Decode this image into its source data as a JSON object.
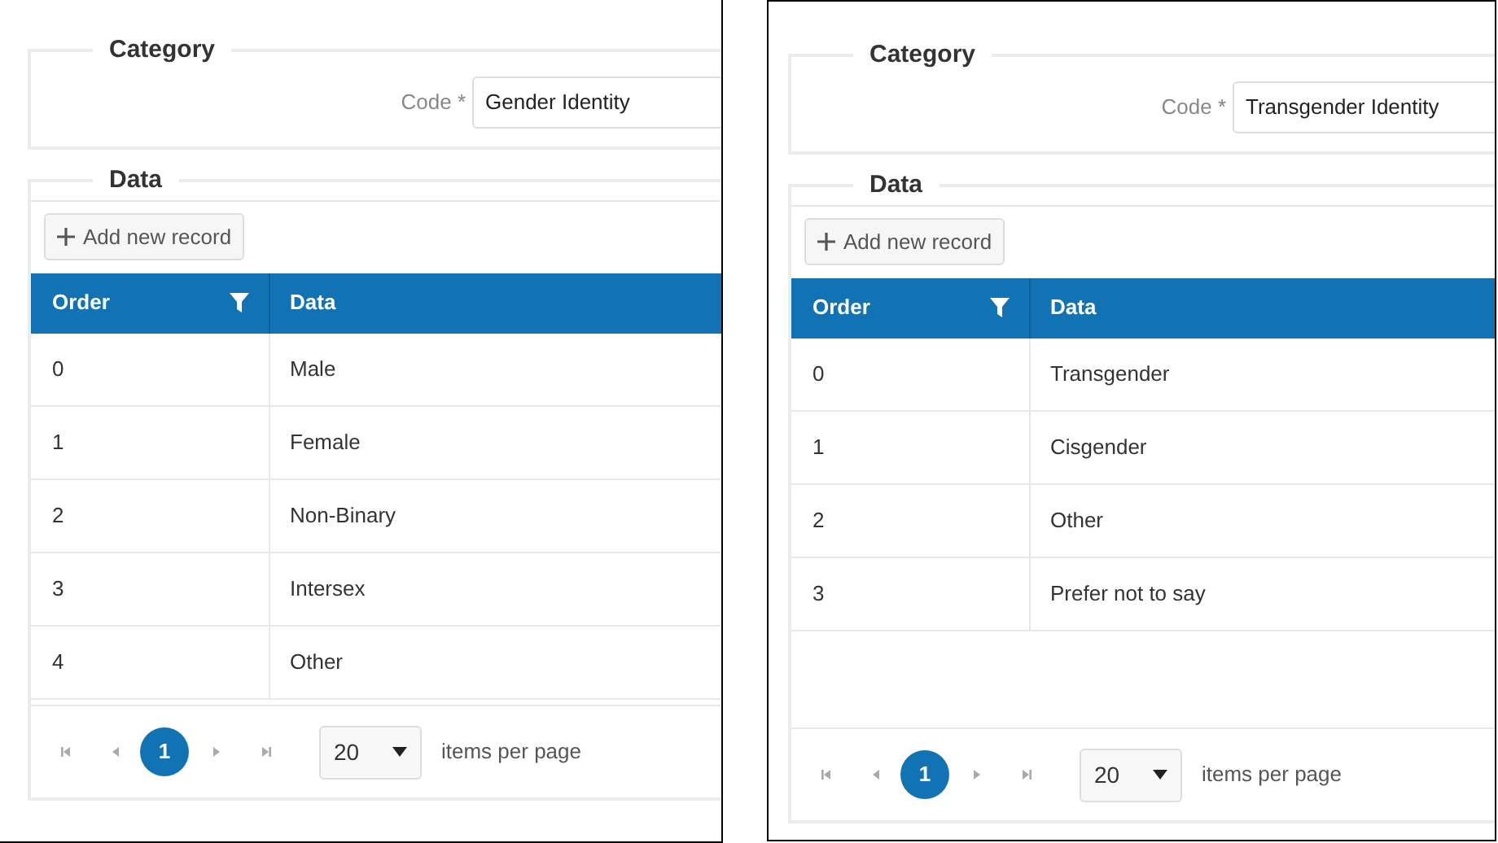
{
  "panels": [
    {
      "category": {
        "legend": "Category",
        "code_label": "Code *",
        "code_value": "Gender Identity"
      },
      "data": {
        "legend": "Data",
        "add_button": "Add new record",
        "columns": [
          "Order",
          "Data"
        ],
        "rows": [
          {
            "order": "0",
            "data": "Male"
          },
          {
            "order": "1",
            "data": "Female"
          },
          {
            "order": "2",
            "data": "Non-Binary"
          },
          {
            "order": "3",
            "data": "Intersex"
          },
          {
            "order": "4",
            "data": "Other"
          }
        ],
        "pager": {
          "pages": [
            {
              "label": "1",
              "selected": true
            }
          ],
          "page_size": "20",
          "page_size_label": "items per page"
        }
      }
    },
    {
      "category": {
        "legend": "Category",
        "code_label": "Code *",
        "code_value": "Transgender Identity"
      },
      "data": {
        "legend": "Data",
        "add_button": "Add new record",
        "columns": [
          "Order",
          "Data"
        ],
        "rows": [
          {
            "order": "0",
            "data": "Transgender"
          },
          {
            "order": "1",
            "data": "Cisgender"
          },
          {
            "order": "2",
            "data": "Other"
          },
          {
            "order": "3",
            "data": "Prefer not to say"
          }
        ],
        "pager": {
          "pages": [
            {
              "label": "1",
              "selected": true
            }
          ],
          "page_size": "20",
          "page_size_label": "items per page"
        }
      }
    }
  ]
}
